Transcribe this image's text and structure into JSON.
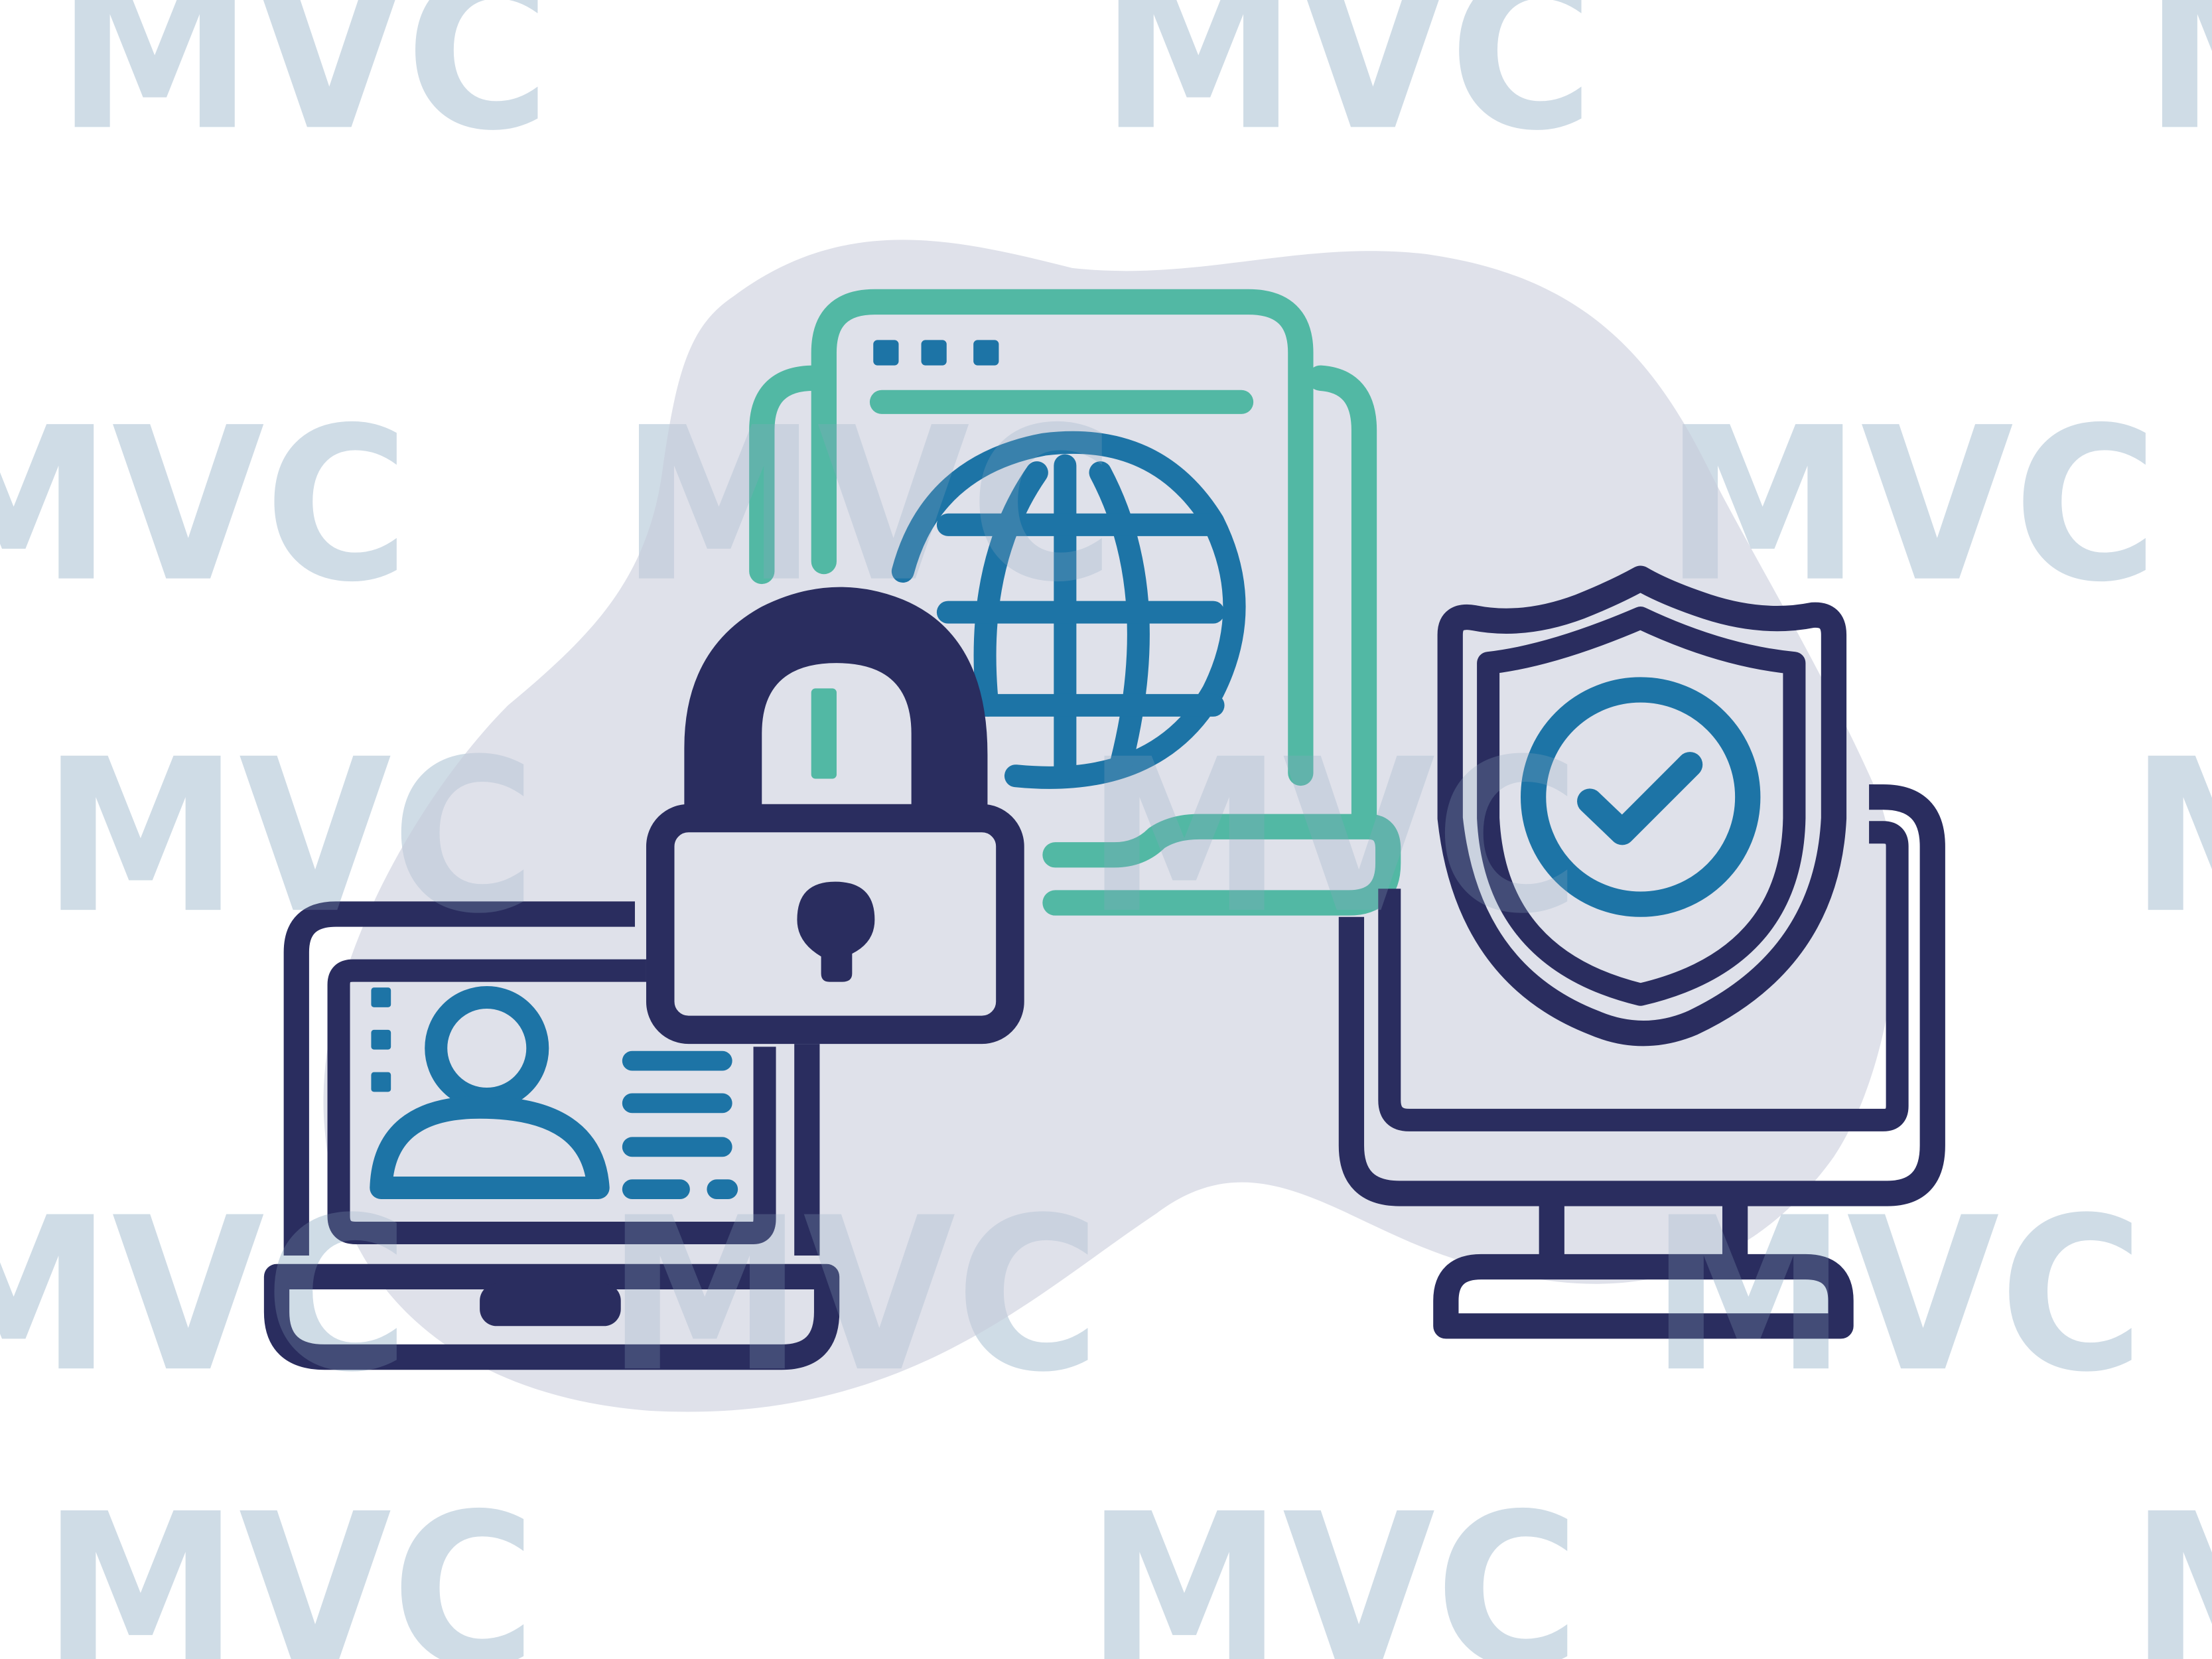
{
  "watermark": {
    "text": "MVC",
    "color": "#e6eef4"
  },
  "colors": {
    "background": "#ffffff",
    "blob": "#dfe1ea",
    "navy": "#2a2d5f",
    "blue": "#1d74a6",
    "teal": "#52b8a4",
    "fill_light": "#dfe1ea"
  },
  "icons": [
    "browser-window-icon",
    "globe-icon",
    "padlock-icon",
    "laptop-icon",
    "user-profile-card-icon",
    "desktop-monitor-icon",
    "shield-check-icon"
  ]
}
